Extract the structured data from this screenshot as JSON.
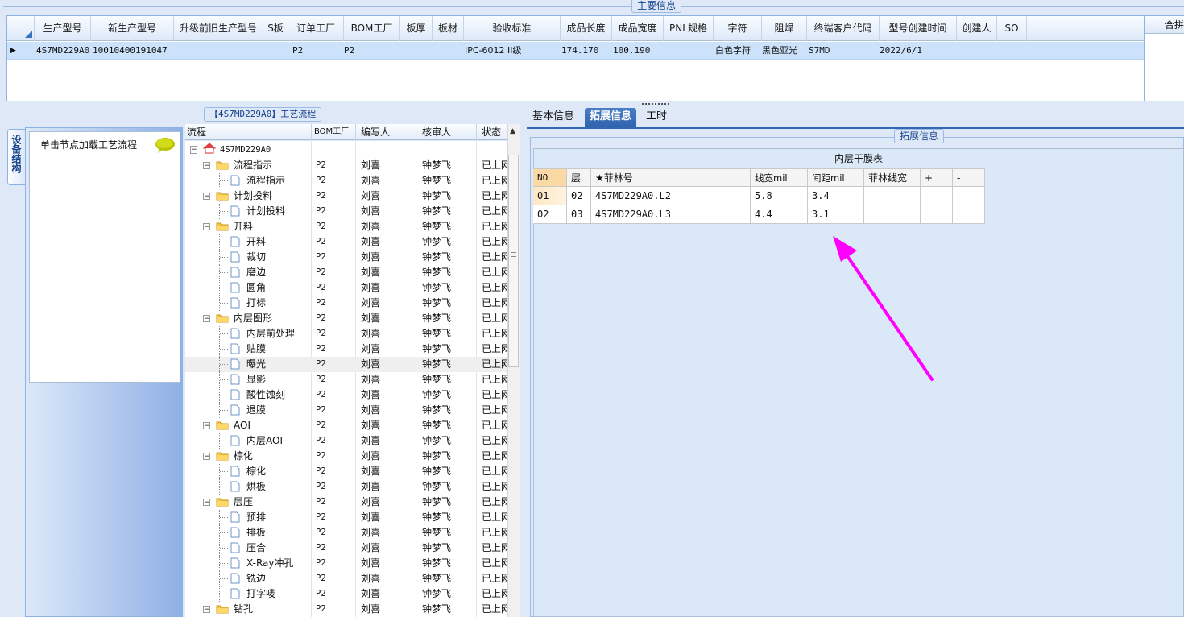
{
  "main_info": {
    "title": "主要信息",
    "columns": [
      "生产型号",
      "新生产型号",
      "升级前旧生产型号",
      "S板",
      "订单工厂",
      "BOM工厂",
      "板厚",
      "板材",
      "验收标准",
      "成品长度",
      "成品宽度",
      "PNL规格",
      "字符",
      "阻焊",
      "终端客户代码",
      "型号创建时间",
      "创建人",
      "SO"
    ],
    "row": [
      "4S7MD229A0",
      "10010400191047",
      "",
      "",
      "P2",
      "P2",
      "",
      "",
      "IPC-6012 II级",
      "174.170",
      "100.190",
      "",
      "白色字符",
      "黑色亚光",
      "S7MD",
      "2022/6/1",
      "",
      ""
    ],
    "right_header": "合拼"
  },
  "sidebar": {
    "vertical_tab": "设备结构",
    "load_tip": "单击节点加载工艺流程"
  },
  "process": {
    "title": "【4S7MD229A0】工艺流程",
    "columns": [
      "流程",
      "BOM工厂",
      "编写人",
      "核审人",
      "状态"
    ],
    "root": "4S7MD229A0",
    "rows": [
      {
        "level": 1,
        "name": "流程指示",
        "bom": "P2",
        "writer": "刘喜",
        "reviewer": "钟梦飞",
        "status": "已上网"
      },
      {
        "level": 2,
        "name": "流程指示",
        "bom": "P2",
        "writer": "刘喜",
        "reviewer": "钟梦飞",
        "status": "已上网"
      },
      {
        "level": 1,
        "name": "计划投料",
        "bom": "P2",
        "writer": "刘喜",
        "reviewer": "钟梦飞",
        "status": "已上网"
      },
      {
        "level": 2,
        "name": "计划投料",
        "bom": "P2",
        "writer": "刘喜",
        "reviewer": "钟梦飞",
        "status": "已上网"
      },
      {
        "level": 1,
        "name": "开料",
        "bom": "P2",
        "writer": "刘喜",
        "reviewer": "钟梦飞",
        "status": "已上网"
      },
      {
        "level": 2,
        "name": "开料",
        "bom": "P2",
        "writer": "刘喜",
        "reviewer": "钟梦飞",
        "status": "已上网"
      },
      {
        "level": 2,
        "name": "裁切",
        "bom": "P2",
        "writer": "刘喜",
        "reviewer": "钟梦飞",
        "status": "已上网"
      },
      {
        "level": 2,
        "name": "磨边",
        "bom": "P2",
        "writer": "刘喜",
        "reviewer": "钟梦飞",
        "status": "已上网"
      },
      {
        "level": 2,
        "name": "圆角",
        "bom": "P2",
        "writer": "刘喜",
        "reviewer": "钟梦飞",
        "status": "已上网"
      },
      {
        "level": 2,
        "name": "打标",
        "bom": "P2",
        "writer": "刘喜",
        "reviewer": "钟梦飞",
        "status": "已上网"
      },
      {
        "level": 1,
        "name": "内层图形",
        "bom": "P2",
        "writer": "刘喜",
        "reviewer": "钟梦飞",
        "status": "已上网"
      },
      {
        "level": 2,
        "name": "内层前处理",
        "bom": "P2",
        "writer": "刘喜",
        "reviewer": "钟梦飞",
        "status": "已上网"
      },
      {
        "level": 2,
        "name": "贴膜",
        "bom": "P2",
        "writer": "刘喜",
        "reviewer": "钟梦飞",
        "status": "已上网"
      },
      {
        "level": 2,
        "name": "曝光",
        "bom": "P2",
        "writer": "刘喜",
        "reviewer": "钟梦飞",
        "status": "已上网",
        "selected": true
      },
      {
        "level": 2,
        "name": "显影",
        "bom": "P2",
        "writer": "刘喜",
        "reviewer": "钟梦飞",
        "status": "已上网"
      },
      {
        "level": 2,
        "name": "酸性蚀刻",
        "bom": "P2",
        "writer": "刘喜",
        "reviewer": "钟梦飞",
        "status": "已上网"
      },
      {
        "level": 2,
        "name": "退膜",
        "bom": "P2",
        "writer": "刘喜",
        "reviewer": "钟梦飞",
        "status": "已上网"
      },
      {
        "level": 1,
        "name": "AOI",
        "bom": "P2",
        "writer": "刘喜",
        "reviewer": "钟梦飞",
        "status": "已上网"
      },
      {
        "level": 2,
        "name": "内层AOI",
        "bom": "P2",
        "writer": "刘喜",
        "reviewer": "钟梦飞",
        "status": "已上网"
      },
      {
        "level": 1,
        "name": "棕化",
        "bom": "P2",
        "writer": "刘喜",
        "reviewer": "钟梦飞",
        "status": "已上网"
      },
      {
        "level": 2,
        "name": "棕化",
        "bom": "P2",
        "writer": "刘喜",
        "reviewer": "钟梦飞",
        "status": "已上网"
      },
      {
        "level": 2,
        "name": "烘板",
        "bom": "P2",
        "writer": "刘喜",
        "reviewer": "钟梦飞",
        "status": "已上网"
      },
      {
        "level": 1,
        "name": "层压",
        "bom": "P2",
        "writer": "刘喜",
        "reviewer": "钟梦飞",
        "status": "已上网"
      },
      {
        "level": 2,
        "name": "预排",
        "bom": "P2",
        "writer": "刘喜",
        "reviewer": "钟梦飞",
        "status": "已上网"
      },
      {
        "level": 2,
        "name": "排板",
        "bom": "P2",
        "writer": "刘喜",
        "reviewer": "钟梦飞",
        "status": "已上网"
      },
      {
        "level": 2,
        "name": "压合",
        "bom": "P2",
        "writer": "刘喜",
        "reviewer": "钟梦飞",
        "status": "已上网"
      },
      {
        "level": 2,
        "name": "X-Ray冲孔",
        "bom": "P2",
        "writer": "刘喜",
        "reviewer": "钟梦飞",
        "status": "已上网"
      },
      {
        "level": 2,
        "name": "铣边",
        "bom": "P2",
        "writer": "刘喜",
        "reviewer": "钟梦飞",
        "status": "已上网"
      },
      {
        "level": 2,
        "name": "打字唛",
        "bom": "P2",
        "writer": "刘喜",
        "reviewer": "钟梦飞",
        "status": "已上网"
      },
      {
        "level": 1,
        "name": "钻孔",
        "bom": "P2",
        "writer": "刘喜",
        "reviewer": "钟梦飞",
        "status": "已上网"
      }
    ]
  },
  "tabs": [
    "基本信息",
    "拓展信息",
    "工时"
  ],
  "active_tab": 1,
  "ext": {
    "group_title": "拓展信息",
    "table_title": "内层干膜表",
    "columns": [
      "NO",
      "层",
      "★菲林号",
      "线宽mil",
      "间距mil",
      "菲林线宽",
      "+",
      "-"
    ],
    "rows": [
      [
        "01",
        "02",
        "4S7MD229A0.L2",
        "5.8",
        "3.4",
        "",
        "",
        ""
      ],
      [
        "02",
        "03",
        "4S7MD229A0.L3",
        "4.4",
        "3.1",
        "",
        "",
        ""
      ]
    ]
  },
  "colors": {
    "accent": "#3468b1",
    "arrow": "#ff00ff",
    "selected_row": "#cce2fa"
  }
}
